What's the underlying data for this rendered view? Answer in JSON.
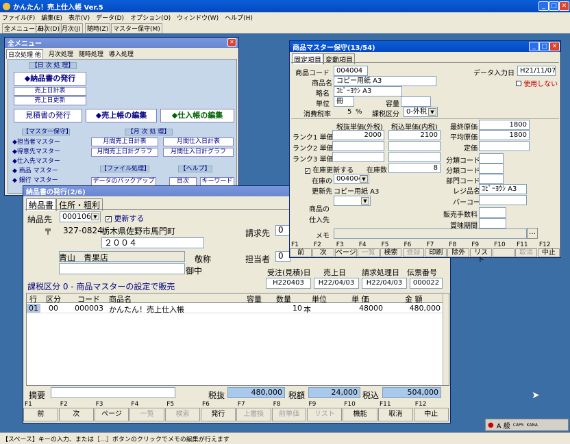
{
  "app": {
    "title": "かんたん！売上仕入帳 Ver.5"
  },
  "menubar": [
    "ファイル(F)",
    "編集(E)",
    "表示(V)",
    "データ(D)",
    "オプション(O)",
    "ウィンドウ(W)",
    "ヘルプ(H)"
  ],
  "toolbar": [
    "全メニュー(A)",
    "日次(D)",
    "月次(J)",
    "随時(Z)",
    "マスター保守(M)"
  ],
  "menu_win": {
    "title": "全メニュー",
    "tabs": [
      "日次処理 他",
      "月次処理",
      "随時処理",
      "導入処理"
    ],
    "daily_header": "【日 次 処 理】",
    "nohin": "◆納品書の発行",
    "uriage_nikkei": "売上日計表",
    "uriage_nikkoushin": "売上日更新",
    "mitsumori": "見積書の発行",
    "uriage_edit": "◆売上帳の編集",
    "shiire_edit": "◆仕入帳の編集",
    "master_header": "【マスター保守】",
    "master_items": [
      "◆担当者マスター",
      "◆得意先マスター",
      "◆仕入先マスター",
      "◆ 商品 マスター",
      "◆ 銀行 マスター"
    ],
    "monthly_header": "【月 次 処 理】",
    "monthly_items": [
      "月間売上日計表",
      "月間仕入日計表",
      "月間売上日計グラフ",
      "月間仕入日計グラフ"
    ],
    "file_header": "【ファイル処理】",
    "file_item": "データのバックアップ",
    "help_header": "【ヘルプ】",
    "help_items": [
      "目次",
      "キーワード"
    ]
  },
  "nohin_win": {
    "title": "納品書の発行(2/6)",
    "tabs": [
      "納品書",
      "住所・粗利"
    ],
    "nohinsaki_label": "納品先",
    "nohinsaki_code": "000106",
    "update_label": "更新する",
    "zip_mark": "〒",
    "zip": "327-0824",
    "address": "栃木県佐野市馬門町",
    "address2": "２００４",
    "customer": "青山　青果店",
    "keisho_label": "敬称",
    "keisho": "御中",
    "seikyu_label": "請求先",
    "seikyu_val": "0",
    "tanto_label": "担当者",
    "tanto_val": "0",
    "header_labels": [
      "受注(見積)日",
      "売上日",
      "請求処理日",
      "伝票番号"
    ],
    "header_values": [
      "H220403",
      "H22/04/03",
      "H22/04/03",
      "000022"
    ],
    "tax_note": "課税区分 0 - 商品マスターの設定で販売",
    "columns": [
      "行",
      "区分",
      "コード",
      "商品名",
      "容量",
      "数量",
      "単位",
      "単 価",
      "金 額"
    ],
    "rows": [
      {
        "no": "01",
        "kubun": "00",
        "code": "000003",
        "name": "かんたん！売上仕入帳",
        "yoryo": "",
        "qty": "10",
        "unit": "本",
        "price": "48000",
        "amount": "480,000"
      }
    ],
    "tekiyo_label": "摘要",
    "totals": {
      "zeinuki_label": "税抜",
      "zeinuki": "480,000",
      "zeigaku_label": "税額",
      "zeigaku": "24,000",
      "zeikomi_label": "税込",
      "zeikomi": "504,000"
    },
    "fkeys": [
      {
        "k": "F1",
        "l": "前"
      },
      {
        "k": "F2",
        "l": "次"
      },
      {
        "k": "F3",
        "l": "ページ"
      },
      {
        "k": "F4",
        "l": "一覧"
      },
      {
        "k": "F5",
        "l": "検索"
      },
      {
        "k": "F6",
        "l": "発行"
      },
      {
        "k": "F7",
        "l": "上書換"
      },
      {
        "k": "F8",
        "l": "前単価"
      },
      {
        "k": "F9",
        "l": "リスト"
      },
      {
        "k": "F10",
        "l": "機能"
      },
      {
        "k": "F11",
        "l": "取消"
      },
      {
        "k": "F12",
        "l": "中止"
      }
    ]
  },
  "master_win": {
    "title": "商品マスター保守(13/54)",
    "tabs": [
      "固定項目",
      "変動項目"
    ],
    "code_label": "商品コード",
    "code": "004004",
    "date_label": "データ入力日",
    "date": "H21/11/07",
    "name_label": "商品名",
    "name": "コピー用紙 A3",
    "unused_label": "使用しない",
    "ryaku_label": "略名",
    "ryaku": "ｺﾋﾟｰﾖｳｼ A3",
    "unit_label": "単位",
    "unit": "冊",
    "yoryo_label": "容量",
    "taxrate_label": "消費税率",
    "taxrate": "5",
    "pct": "%",
    "taxkubun_label": "課税区分",
    "taxkubun": "0-外税",
    "price_headers": [
      "税抜単価(外税)",
      "税込単価(内税)"
    ],
    "rank_labels": [
      "ランク1 単価",
      "ランク2 単価",
      "ランク3 単価"
    ],
    "rank1": [
      "2000",
      "2100"
    ],
    "cost_labels": [
      "最終原価",
      "平均原価",
      "定価"
    ],
    "costs": [
      "1800",
      "1800",
      ""
    ],
    "zaiko_upd_label": "在庫更新する",
    "zaikosu_label": "在庫数",
    "zaikosu": "8",
    "zaikono_label": "在庫の",
    "zaikono": "004004",
    "koushin_label": "更新先",
    "koushin": "コピー用紙 A3",
    "shohin_label": "商品の",
    "shiire_label": "仕入先",
    "bunrui_labels": [
      "分類コード",
      "分類コード2",
      "部門コード"
    ],
    "regi_label": "レジ品名",
    "regi": "ｺﾋﾟｰﾖｳｼ A3",
    "barcode_label": "バーコード",
    "tesuryo_label": "販売手数料",
    "kigen_label": "賞味期間",
    "memo_label": "メモ",
    "memo_btn": "…",
    "fkeys": [
      {
        "k": "F1",
        "l": "前"
      },
      {
        "k": "F2",
        "l": "次"
      },
      {
        "k": "F3",
        "l": "ページ"
      },
      {
        "k": "F4",
        "l": "一覧"
      },
      {
        "k": "F5",
        "l": "検索"
      },
      {
        "k": "F6",
        "l": "登録"
      },
      {
        "k": "F7",
        "l": "印刷"
      },
      {
        "k": "F8",
        "l": "除外"
      },
      {
        "k": "F9",
        "l": "リスト"
      },
      {
        "k": "F10",
        "l": ""
      },
      {
        "k": "F11",
        "l": "取消"
      },
      {
        "k": "F12",
        "l": "中止"
      }
    ]
  },
  "status": {
    "text": "【スペース】キーの入力、または［…］ボタンのクリックでメモの編集が行えます"
  },
  "tray": {
    "ime": "A 般",
    "caps": "CAPS",
    "kana": "KANA"
  }
}
